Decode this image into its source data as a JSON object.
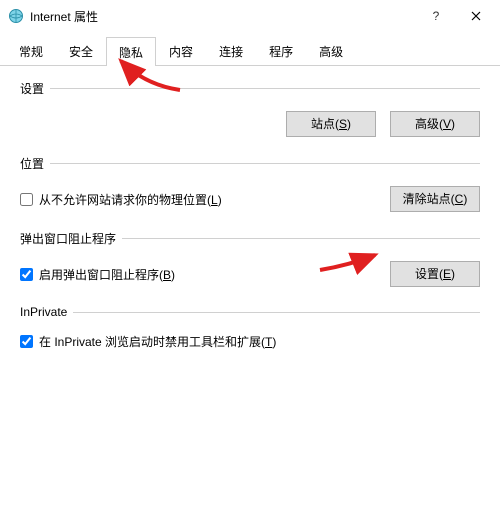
{
  "window": {
    "title": "Internet 属性"
  },
  "tabs": [
    "常规",
    "安全",
    "隐私",
    "内容",
    "连接",
    "程序",
    "高级"
  ],
  "sections": {
    "settings": {
      "label": "设置",
      "sites_btn": "站点(S)",
      "advanced_btn": "高级(V)"
    },
    "location": {
      "label": "位置",
      "checkbox": "从不允许网站请求你的物理位置(L)",
      "clear_btn": "清除站点(C)"
    },
    "popup": {
      "label": "弹出窗口阻止程序",
      "checkbox": "启用弹出窗口阻止程序(B)",
      "settings_btn": "设置(E)"
    },
    "inprivate": {
      "label": "InPrivate",
      "checkbox": "在 InPrivate 浏览启动时禁用工具栏和扩展(T)"
    }
  }
}
